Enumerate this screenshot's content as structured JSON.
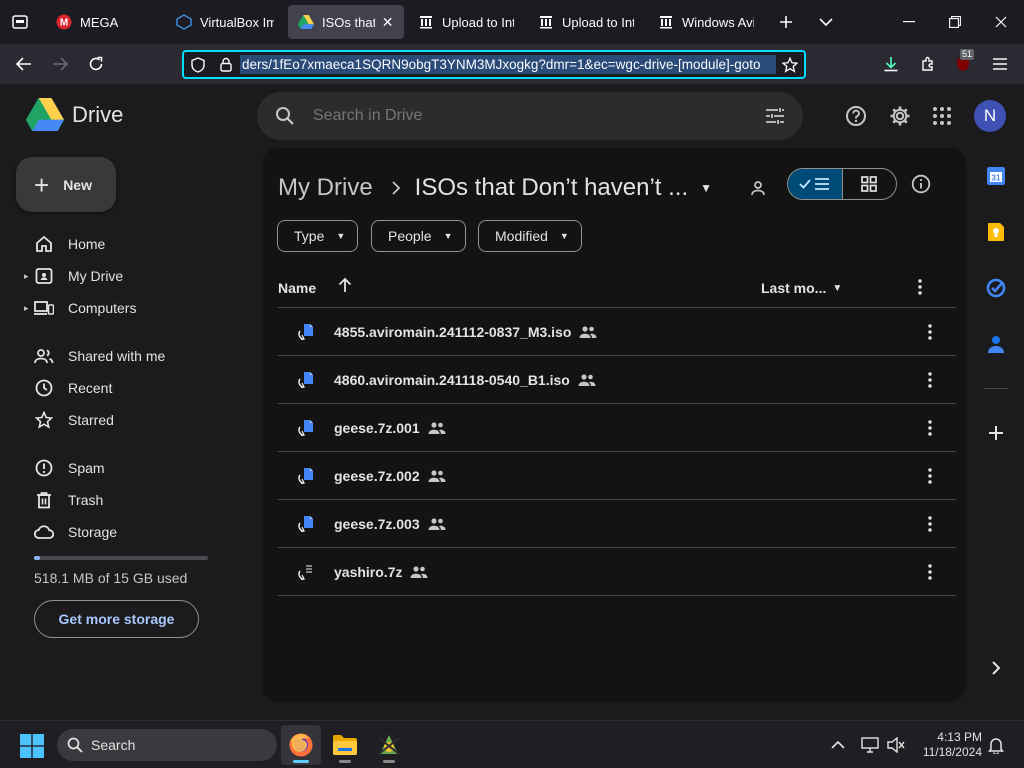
{
  "browser": {
    "tabs": [
      {
        "title": "MEGA",
        "favicon": "mega-icon"
      },
      {
        "title": "VirtualBox Ima",
        "favicon": "virtualbox-icon"
      },
      {
        "title": "ISOs that D",
        "favicon": "drive-icon",
        "active": true
      },
      {
        "title": "Upload to Inte",
        "favicon": "archive-icon"
      },
      {
        "title": "Upload to Inte",
        "favicon": "archive-icon"
      },
      {
        "title": "Windows Avir",
        "favicon": "archive-icon"
      }
    ],
    "url": "ders/1fEo7xmaeca1SQRN9obgT3YNM3MJxogkg?dmr=1&ec=wgc-drive-[module]-goto",
    "extensions_badge": "51"
  },
  "drive": {
    "logo_text": "Drive",
    "search_placeholder": "Search in Drive",
    "avatar_letter": "N",
    "new_label": "New",
    "nav": {
      "home": "Home",
      "my_drive": "My Drive",
      "computers": "Computers",
      "shared": "Shared with me",
      "recent": "Recent",
      "starred": "Starred",
      "spam": "Spam",
      "trash": "Trash",
      "storage": "Storage"
    },
    "storage_used_fraction": 0.035,
    "storage_text": "518.1 MB of 15 GB used",
    "more_storage_label": "Get more storage",
    "breadcrumb_root": "My Drive",
    "breadcrumb_current": "ISOs that Don’t haven’t ...",
    "filters": {
      "type": "Type",
      "people": "People",
      "modified": "Modified"
    },
    "columns": {
      "name": "Name",
      "modified": "Last mo..."
    },
    "files": [
      {
        "name": "4855.aviromain.241112-0837_M3.iso",
        "icon": "disc-image-icon",
        "shared": true
      },
      {
        "name": "4860.aviromain.241118-0540_B1.iso",
        "icon": "disc-image-icon",
        "shared": true
      },
      {
        "name": "geese.7z.001",
        "icon": "file-icon",
        "shared": true
      },
      {
        "name": "geese.7z.002",
        "icon": "file-icon",
        "shared": true
      },
      {
        "name": "geese.7z.003",
        "icon": "file-icon",
        "shared": true
      },
      {
        "name": "yashiro.7z",
        "icon": "archive-file-icon",
        "shared": true
      }
    ]
  },
  "taskbar": {
    "search_label": "Search",
    "time": "4:13 PM",
    "date": "11/18/2024"
  },
  "colors": {
    "accent_url": "#00ddff",
    "drive_blue": "#a8c7fa",
    "view_toggle_on": "#004a77"
  }
}
